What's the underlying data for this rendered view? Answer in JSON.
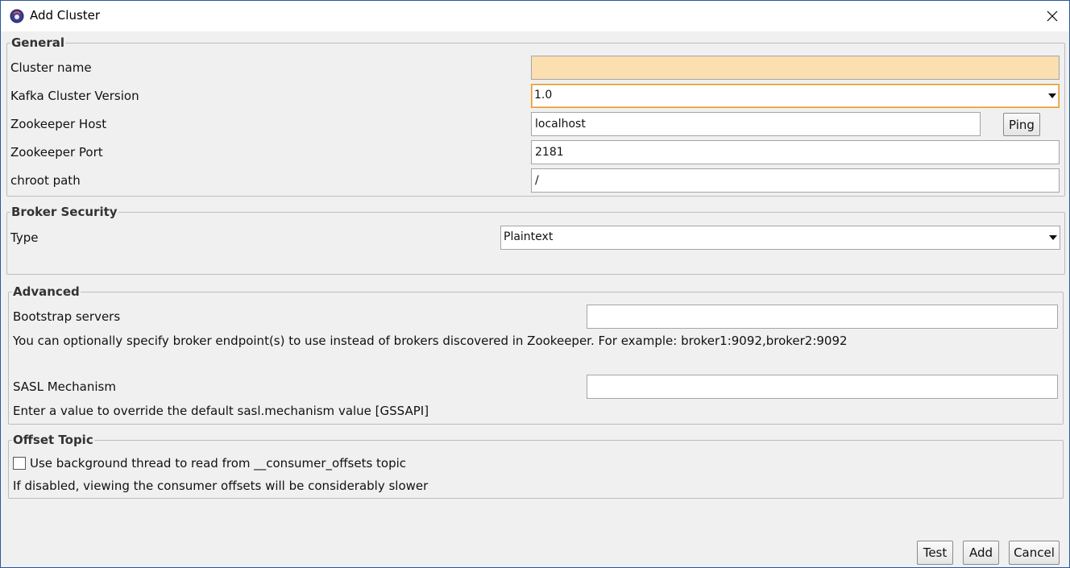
{
  "window": {
    "title": "Add Cluster",
    "icon": "kafka-tool-icon"
  },
  "general": {
    "legend": "General",
    "cluster_name": {
      "label": "Cluster name",
      "value": "",
      "background_color": "#fbdfb1"
    },
    "kafka_version": {
      "label": "Kafka Cluster Version",
      "value": "1.0"
    },
    "zookeeper_host": {
      "label": "Zookeeper Host",
      "value": "localhost"
    },
    "ping_button": "Ping",
    "zookeeper_port": {
      "label": "Zookeeper Port",
      "value": "2181"
    },
    "chroot_path": {
      "label": "chroot path",
      "value": "/"
    }
  },
  "broker_security": {
    "legend": "Broker Security",
    "type": {
      "label": "Type",
      "value": "Plaintext"
    }
  },
  "advanced": {
    "legend": "Advanced",
    "bootstrap_servers": {
      "label": "Bootstrap servers",
      "value": ""
    },
    "bootstrap_help": "You can optionally specify broker endpoint(s) to use instead of brokers discovered in Zookeeper. For example: broker1:9092,broker2:9092",
    "sasl_mechanism": {
      "label": "SASL Mechanism",
      "value": ""
    },
    "sasl_help": "Enter a value to override the default sasl.mechanism value [GSSAPI]"
  },
  "offset_topic": {
    "legend": "Offset Topic",
    "checkbox_label": "Use background thread to read from __consumer_offsets topic",
    "checked": false,
    "help": "If disabled, viewing the consumer offsets will be considerably slower"
  },
  "buttons": {
    "test": "Test",
    "add": "Add",
    "cancel": "Cancel"
  }
}
